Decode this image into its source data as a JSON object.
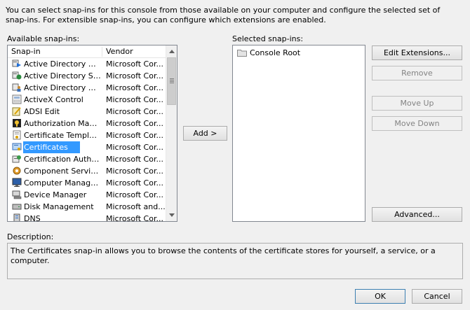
{
  "intro_text": "You can select snap-ins for this console from those available on your computer and configure the selected set of snap-ins. For extensible snap-ins, you can configure which extensions are enabled.",
  "available": {
    "label": "Available snap-ins:",
    "columns": {
      "snapin": "Snap-in",
      "vendor": "Vendor"
    },
    "rows": [
      {
        "name": "Active Directory Do...",
        "vendor": "Microsoft Cor...",
        "icon": "ad-domains-icon"
      },
      {
        "name": "Active Directory Site...",
        "vendor": "Microsoft Cor...",
        "icon": "ad-sites-icon"
      },
      {
        "name": "Active Directory Use...",
        "vendor": "Microsoft Cor...",
        "icon": "ad-users-icon"
      },
      {
        "name": "ActiveX Control",
        "vendor": "Microsoft Cor...",
        "icon": "activex-icon"
      },
      {
        "name": "ADSI Edit",
        "vendor": "Microsoft Cor...",
        "icon": "adsi-edit-icon"
      },
      {
        "name": "Authorization Manager",
        "vendor": "Microsoft Cor...",
        "icon": "authorization-icon"
      },
      {
        "name": "Certificate Templates",
        "vendor": "Microsoft Cor...",
        "icon": "cert-templates-icon"
      },
      {
        "name": "Certificates",
        "vendor": "Microsoft Cor...",
        "icon": "certificates-icon",
        "selected": true
      },
      {
        "name": "Certification Authority",
        "vendor": "Microsoft Cor...",
        "icon": "cert-authority-icon"
      },
      {
        "name": "Component Services",
        "vendor": "Microsoft Cor...",
        "icon": "component-services-icon"
      },
      {
        "name": "Computer Managem...",
        "vendor": "Microsoft Cor...",
        "icon": "computer-management-icon"
      },
      {
        "name": "Device Manager",
        "vendor": "Microsoft Cor...",
        "icon": "device-manager-icon"
      },
      {
        "name": "Disk Management",
        "vendor": "Microsoft and...",
        "icon": "disk-management-icon"
      },
      {
        "name": "DNS",
        "vendor": "Microsoft Cor...",
        "icon": "dns-icon"
      }
    ]
  },
  "add_button": "Add >",
  "selected": {
    "label": "Selected snap-ins:",
    "items": [
      {
        "name": "Console Root",
        "icon": "folder-icon"
      }
    ]
  },
  "buttons": {
    "edit_extensions": "Edit Extensions...",
    "remove": "Remove",
    "move_up": "Move Up",
    "move_down": "Move Down",
    "advanced": "Advanced...",
    "ok": "OK",
    "cancel": "Cancel"
  },
  "description": {
    "label": "Description:",
    "text": "The Certificates snap-in allows you to browse the contents of the certificate stores for yourself, a service, or a computer."
  }
}
